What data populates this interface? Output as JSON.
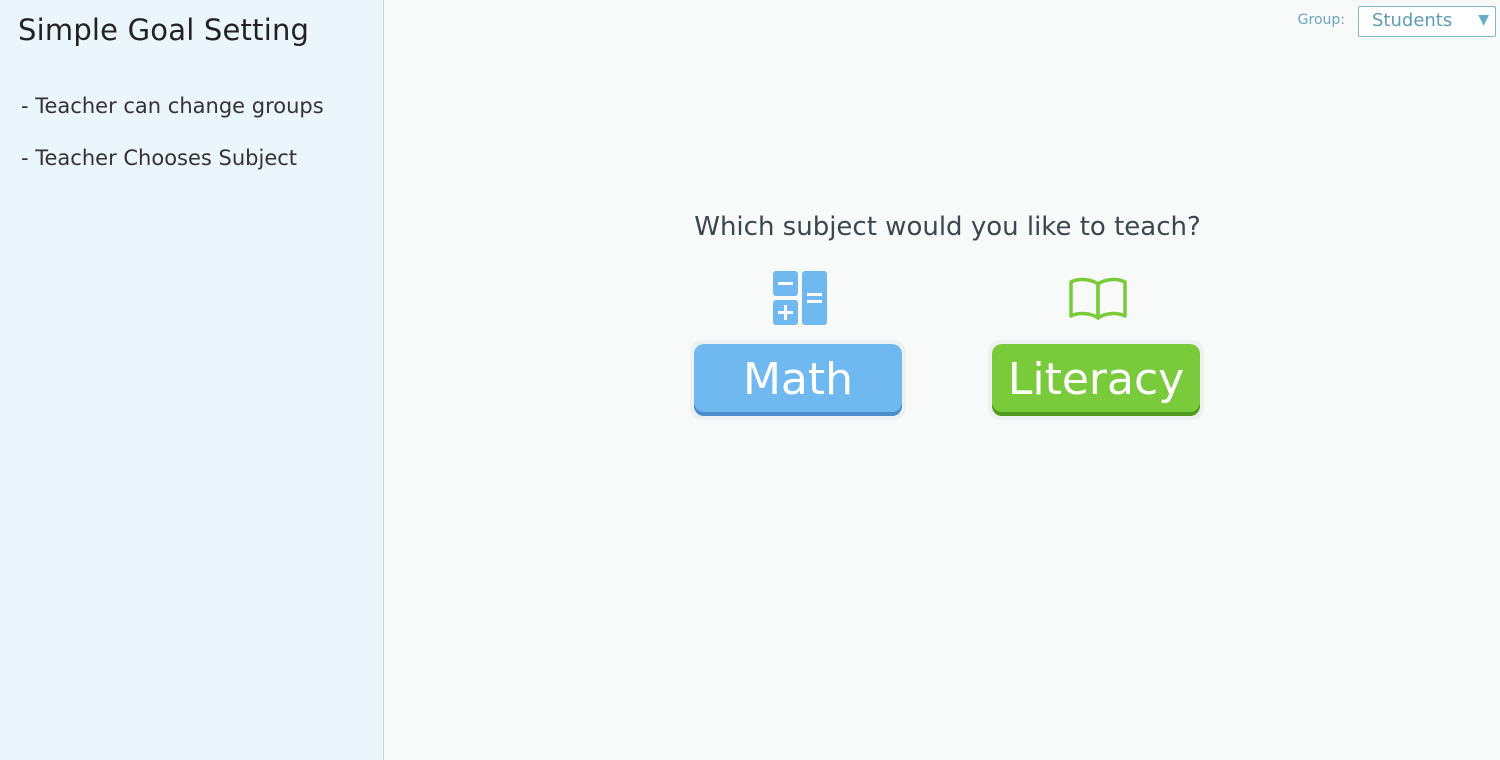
{
  "sidebar": {
    "title": "Simple Goal Setting",
    "items": [
      {
        "label": "- Teacher can change groups"
      },
      {
        "label": "- Teacher Chooses Subject"
      }
    ]
  },
  "header": {
    "group_label": "Group:",
    "group_select": {
      "value": "Students",
      "arrow_icon": "triangle-down-icon"
    }
  },
  "main": {
    "question": "Which subject would you like to teach?",
    "subjects": [
      {
        "label": "Math",
        "icon": "calculator-icon",
        "color": "#6fb8f0"
      },
      {
        "label": "Literacy",
        "icon": "open-book-icon",
        "color": "#7acb3c"
      }
    ]
  },
  "colors": {
    "sidebar_bg": "#eaf5fc",
    "main_bg": "#f8f9f9",
    "math_accent": "#6fb8f0",
    "literacy_accent": "#7acb3c",
    "select_accent": "#5c9db0"
  }
}
